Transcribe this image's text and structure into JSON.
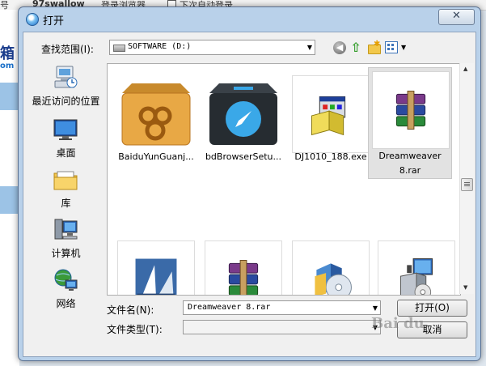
{
  "background": {
    "tab_fragments": [
      "号",
      "97swallow",
      "登录浏览器",
      "下次自动登录"
    ],
    "logo_text": "箱",
    "logo_sub": "om"
  },
  "dialog": {
    "title": "打开",
    "close_label": "✕",
    "look_in_label": "查找范围(I):",
    "look_in_value": "SOFTWARE (D:)",
    "places": [
      {
        "label": "最近访问的位置",
        "icon": "recent-places-icon"
      },
      {
        "label": "桌面",
        "icon": "desktop-icon"
      },
      {
        "label": "库",
        "icon": "libraries-icon"
      },
      {
        "label": "计算机",
        "icon": "computer-icon"
      },
      {
        "label": "网络",
        "icon": "network-icon"
      }
    ],
    "files": [
      {
        "name": "BaiduYunGuanj...",
        "icon": "baidu-cloud-box-icon"
      },
      {
        "name": "bdBrowserSetu...",
        "icon": "baidu-browser-box-icon"
      },
      {
        "name": "DJ1010_188.exe",
        "icon": "installer-exe-icon"
      },
      {
        "name": "Dreamweaver 8.rar",
        "name_line1": "Dreamweaver",
        "name_line2": "8.rar",
        "icon": "winrar-archive-icon",
        "selected": true
      },
      {
        "name": "",
        "icon": "sail-app-icon"
      },
      {
        "name": "",
        "icon": "winrar-archive-icon"
      },
      {
        "name": "",
        "icon": "cd-installer-icon"
      },
      {
        "name": "",
        "icon": "monitor-installer-icon"
      }
    ],
    "file_name_label": "文件名(N):",
    "file_name_value": "Dreamweaver 8.rar",
    "file_type_label": "文件类型(T):",
    "file_type_value": "",
    "open_button": "打开(O)",
    "cancel_button": "取消",
    "watermark": "Bai du"
  }
}
